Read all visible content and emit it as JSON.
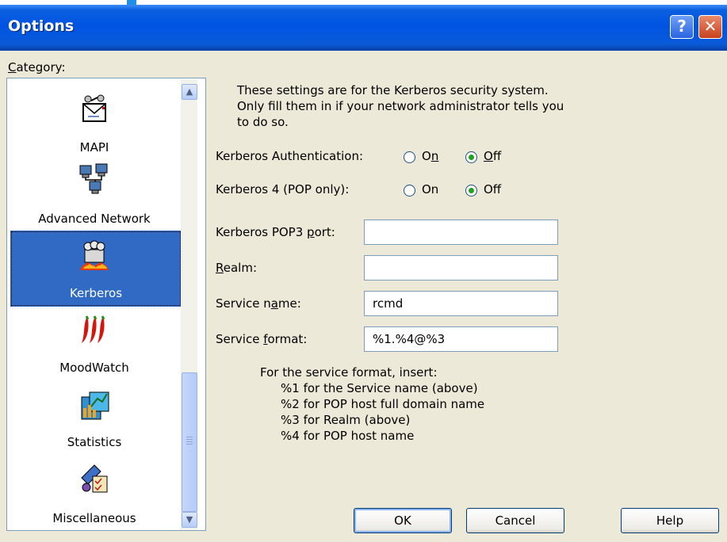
{
  "window": {
    "title": "Options",
    "help_glyph": "?",
    "close_glyph": "✕"
  },
  "category": {
    "label_prefix": "C",
    "label_rest": "ategory:",
    "items": [
      {
        "label": "MAPI",
        "icon": "mapi-icon"
      },
      {
        "label": "Advanced Network",
        "icon": "network-computers-icon"
      },
      {
        "label": "Kerberos",
        "icon": "kerberos-dog-icon",
        "selected": true
      },
      {
        "label": "MoodWatch",
        "icon": "chili-peppers-icon"
      },
      {
        "label": "Statistics",
        "icon": "statistics-chart-icon"
      },
      {
        "label": "Miscellaneous",
        "icon": "miscellaneous-icon"
      }
    ]
  },
  "kerberos": {
    "description": "These settings are for the Kerberos security system. Only fill them in if your network administrator tells you to do so.",
    "auth_label": "Kerberos Authentication:",
    "auth_on_a": "O",
    "auth_on_u": "n",
    "auth_off_a": "",
    "auth_off_u": "O",
    "auth_off_b": "ff",
    "auth_value": "Off",
    "k4_label": "Kerberos 4 (POP only):",
    "k4_on": "On",
    "k4_off": "Off",
    "k4_value": "Off",
    "pop3_label_a": "Kerberos POP3 ",
    "pop3_label_u": "p",
    "pop3_label_b": "ort:",
    "pop3_value": "",
    "realm_label_u": "R",
    "realm_label_b": "ealm:",
    "realm_value": "",
    "service_name_label_a": "Service n",
    "service_name_label_u": "a",
    "service_name_label_b": "me:",
    "service_name_value": "rcmd",
    "service_format_label_a": "Service ",
    "service_format_label_u": "f",
    "service_format_label_b": "ormat:",
    "service_format_value": "%1.%4@%3",
    "hint_title": "For the service format, insert:",
    "hint_lines": [
      "%1 for the Service name (above)",
      "%2 for POP host full domain name",
      "%3 for Realm (above)",
      "%4 for POP host name"
    ]
  },
  "buttons": {
    "ok": "OK",
    "cancel": "Cancel",
    "help": "Help"
  },
  "colors": {
    "titlebar": "#0054e3",
    "selected_item": "#316ac5",
    "dialog_bg": "#ece9d8"
  }
}
